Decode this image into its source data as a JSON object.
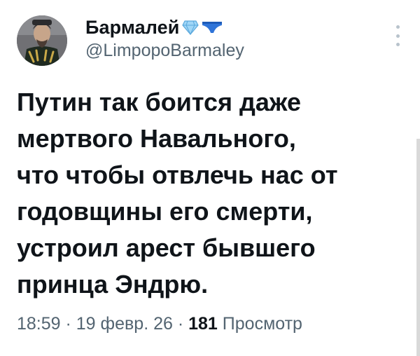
{
  "tweet": {
    "author": {
      "display_name": "Бармалей",
      "badge_emojis": [
        "gem-emoji",
        "briefs-emoji"
      ],
      "handle": "@LimpopoBarmaley",
      "avatar_icon": "avatar-uniformed-man"
    },
    "text": "Путин так боится даже\nмертвого Навального,\nчто чтобы отвлечь нас от\nгодовщины его смерти,\nустроил арест бывшего\nпринца Эндрю.",
    "meta": {
      "time": "18:59",
      "sep1": " · ",
      "date": "19 февр. 26",
      "sep2": " · ",
      "views_count": "181",
      "views_label": " Просмотр"
    }
  },
  "colors": {
    "text": "#0f1419",
    "secondary": "#536471",
    "gem": "#7fc4ef",
    "briefs": "#2f74d8"
  }
}
